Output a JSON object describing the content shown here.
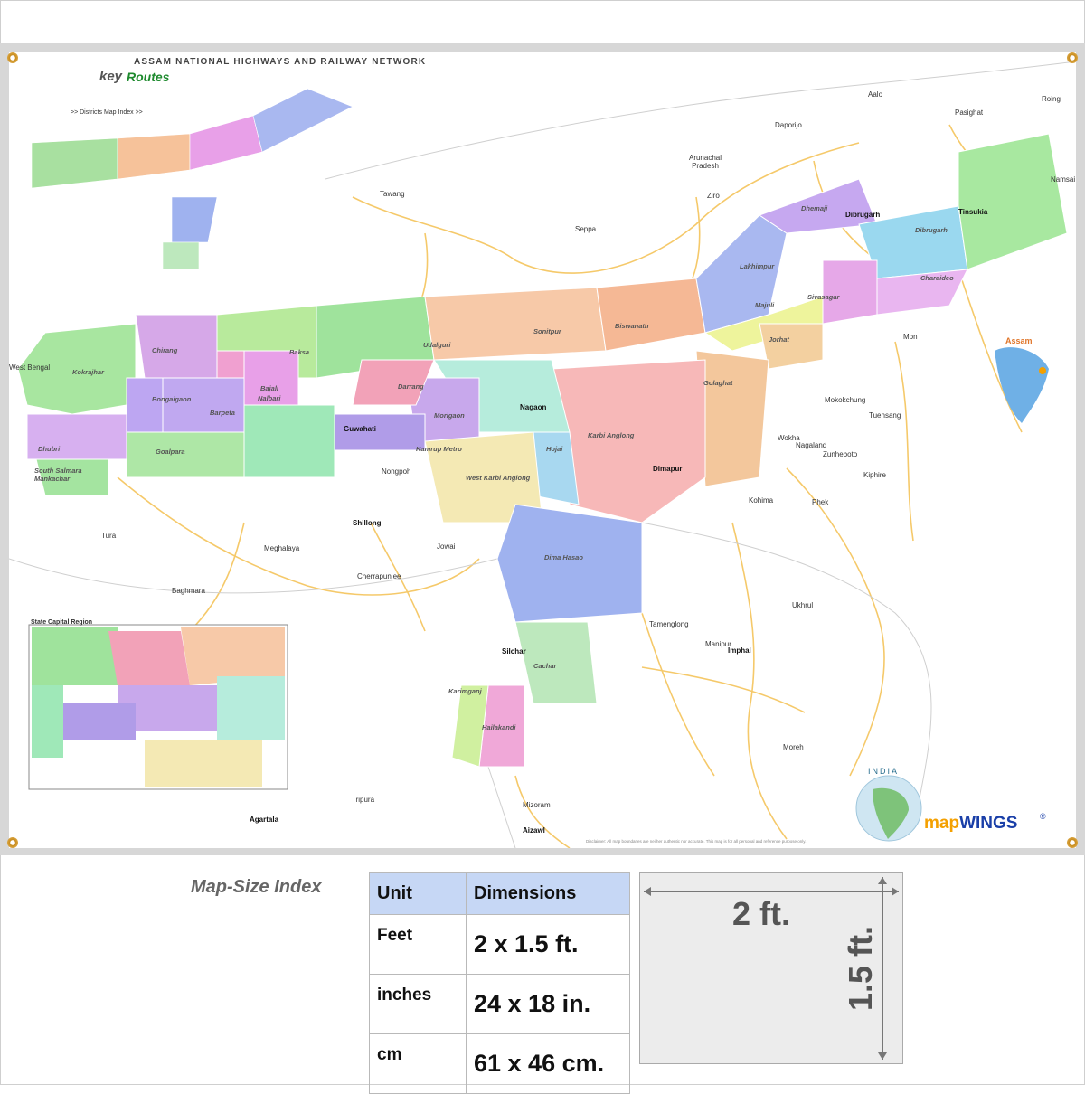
{
  "header": {
    "title": "ASSAM NATIONAL HIGHWAYS AND RAILWAY NETWORK",
    "logo_key": "key",
    "logo_routes": "Routes",
    "districts_index": ">> Districts Map Index >>",
    "inset_title": "State Capital Region"
  },
  "districts": [
    {
      "name": "Kokrajhar"
    },
    {
      "name": "Chirang"
    },
    {
      "name": "Baksa"
    },
    {
      "name": "Udalguri"
    },
    {
      "name": "Bongaigaon"
    },
    {
      "name": "Barpeta"
    },
    {
      "name": "Nalbari"
    },
    {
      "name": "Bajali"
    },
    {
      "name": "Darrang"
    },
    {
      "name": "Sonitpur"
    },
    {
      "name": "Biswanath"
    },
    {
      "name": "Morigaon"
    },
    {
      "name": "Nagaon"
    },
    {
      "name": "Hojai"
    },
    {
      "name": "Karbi Anglong"
    },
    {
      "name": "West Karbi Anglong"
    },
    {
      "name": "Kamrup Metro"
    },
    {
      "name": "Goalpara"
    },
    {
      "name": "Dhubri"
    },
    {
      "name": "South Salmara Mankachar"
    },
    {
      "name": "Golaghat"
    },
    {
      "name": "Jorhat"
    },
    {
      "name": "Majuli"
    },
    {
      "name": "Sivasagar"
    },
    {
      "name": "Charaideo"
    },
    {
      "name": "Lakhimpur"
    },
    {
      "name": "Dhemaji"
    },
    {
      "name": "Dibrugarh"
    },
    {
      "name": "Tinsukia"
    },
    {
      "name": "Dima Hasao"
    },
    {
      "name": "Cachar"
    },
    {
      "name": "Karimganj"
    },
    {
      "name": "Hailakandi"
    }
  ],
  "cities": [
    {
      "name": "Guwahati"
    },
    {
      "name": "Nagaon"
    },
    {
      "name": "Dibrugarh"
    },
    {
      "name": "Tinsukia"
    },
    {
      "name": "Dimapur"
    },
    {
      "name": "Silchar"
    },
    {
      "name": "Shillong"
    },
    {
      "name": "Imphal"
    },
    {
      "name": "Aizawl"
    },
    {
      "name": "Agartala"
    }
  ],
  "neighbours": [
    {
      "name": "West Bengal"
    },
    {
      "name": "Meghalaya"
    },
    {
      "name": "Arunachal Pradesh"
    },
    {
      "name": "Nagaland"
    },
    {
      "name": "Manipur"
    },
    {
      "name": "Mizoram"
    },
    {
      "name": "Tripura"
    },
    {
      "name": "Tawang"
    },
    {
      "name": "Seppa"
    },
    {
      "name": "Ziro"
    },
    {
      "name": "Daporijo"
    },
    {
      "name": "Aalo"
    },
    {
      "name": "Pasighat"
    },
    {
      "name": "Roing"
    },
    {
      "name": "Namsai"
    },
    {
      "name": "Mon"
    },
    {
      "name": "Mokokchung"
    },
    {
      "name": "Tuensang"
    },
    {
      "name": "Wokha"
    },
    {
      "name": "Zunheboto"
    },
    {
      "name": "Kiphire"
    },
    {
      "name": "Phek"
    },
    {
      "name": "Kohima"
    },
    {
      "name": "Tamenglong"
    },
    {
      "name": "Ukhrul"
    },
    {
      "name": "Moreh"
    },
    {
      "name": "Cherrapunjee"
    },
    {
      "name": "Baghmara"
    },
    {
      "name": "Tura"
    },
    {
      "name": "Nongpoh"
    },
    {
      "name": "Jowai"
    }
  ],
  "legend": {
    "assam_label": "Assam",
    "india_label": "INDIA",
    "brand_prefix": "map",
    "brand_suffix": "WINGS",
    "registered": "®",
    "disclaimer": "Disclaimer: All map boundaries are neither authentic nor accurate. This map is for all personal and reference purpose only."
  },
  "size_index": {
    "title": "Map-Size Index",
    "columns": [
      "Unit",
      "Dimensions"
    ],
    "rows": [
      {
        "unit": "Feet",
        "dimensions": "2 x 1.5 ft."
      },
      {
        "unit": "inches",
        "dimensions": "24 x 18 in."
      },
      {
        "unit": "cm",
        "dimensions": "61 x 46 cm."
      }
    ],
    "width_label": "2 ft.",
    "height_label": "1.5 ft."
  },
  "colors": {
    "road": "#f5c96a",
    "border": "#bbbbbb",
    "brand_orange": "#f4a000",
    "brand_blue": "#1a3fa8",
    "table_header": "#c6d7f5"
  }
}
